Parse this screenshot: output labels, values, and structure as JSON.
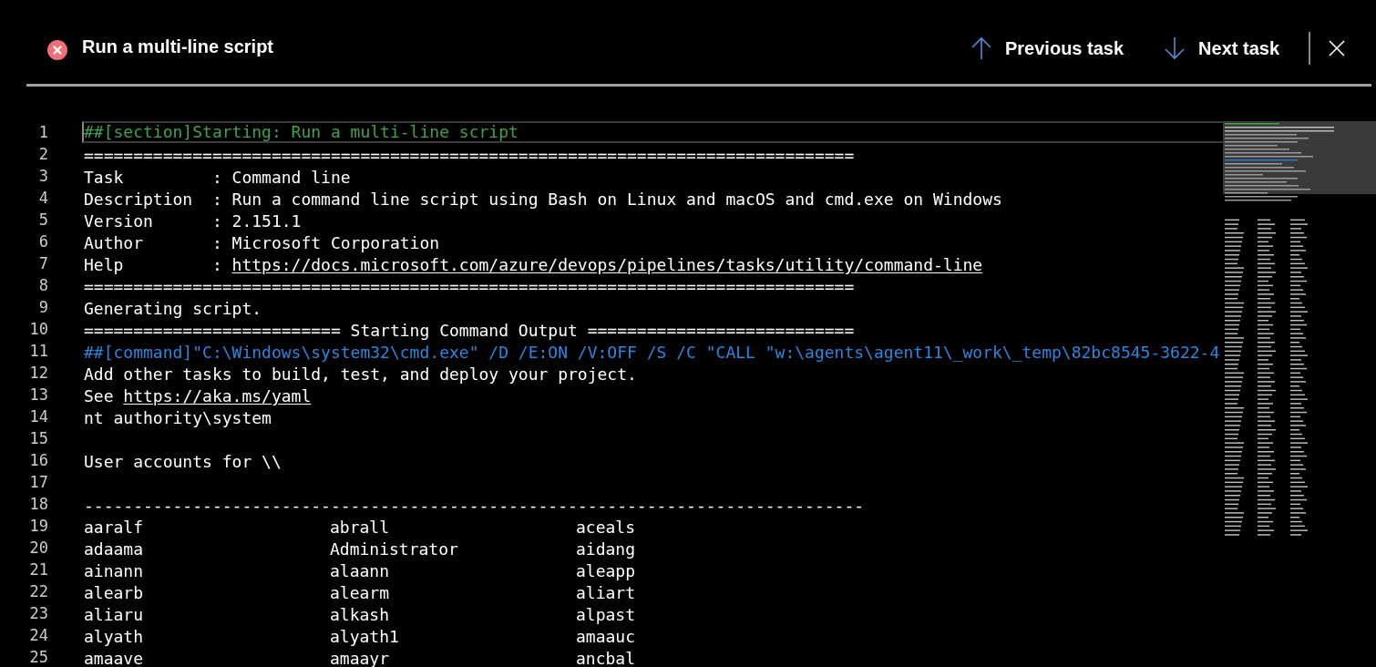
{
  "header": {
    "title": "Run a multi-line script",
    "failed": true,
    "previous": "Previous task",
    "next": "Next task"
  },
  "log": [
    {
      "number": "1",
      "kind": "section",
      "current": true,
      "segments": [
        {
          "text": "##[section]Starting: Run a multi-line script",
          "link": false
        }
      ]
    },
    {
      "number": "2",
      "kind": "plain",
      "current": false,
      "segments": [
        {
          "text": "==============================================================================",
          "link": false
        }
      ]
    },
    {
      "number": "3",
      "kind": "plain",
      "current": false,
      "segments": [
        {
          "text": "Task         : Command line",
          "link": false
        }
      ]
    },
    {
      "number": "4",
      "kind": "plain",
      "current": false,
      "segments": [
        {
          "text": "Description  : Run a command line script using Bash on Linux and macOS and cmd.exe on Windows",
          "link": false
        }
      ]
    },
    {
      "number": "5",
      "kind": "plain",
      "current": false,
      "segments": [
        {
          "text": "Version      : 2.151.1",
          "link": false
        }
      ]
    },
    {
      "number": "6",
      "kind": "plain",
      "current": false,
      "segments": [
        {
          "text": "Author       : Microsoft Corporation",
          "link": false
        }
      ]
    },
    {
      "number": "7",
      "kind": "plain",
      "current": false,
      "segments": [
        {
          "text": "Help         : ",
          "link": false
        },
        {
          "text": "https://docs.microsoft.com/azure/devops/pipelines/tasks/utility/command-line",
          "link": true
        }
      ]
    },
    {
      "number": "8",
      "kind": "plain",
      "current": false,
      "segments": [
        {
          "text": "==============================================================================",
          "link": false
        }
      ]
    },
    {
      "number": "9",
      "kind": "plain",
      "current": false,
      "segments": [
        {
          "text": "Generating script.",
          "link": false
        }
      ]
    },
    {
      "number": "10",
      "kind": "plain",
      "current": false,
      "segments": [
        {
          "text": "========================== Starting Command Output ===========================",
          "link": false
        }
      ]
    },
    {
      "number": "11",
      "kind": "command",
      "current": false,
      "segments": [
        {
          "text": "##[command]\"C:\\Windows\\system32\\cmd.exe\" /D /E:ON /V:OFF /S /C \"CALL \"w:\\agents\\agent11\\_work\\_temp\\82bc8545-3622-4",
          "link": false
        }
      ]
    },
    {
      "number": "12",
      "kind": "plain",
      "current": false,
      "segments": [
        {
          "text": "Add other tasks to build, test, and deploy your project.",
          "link": false
        }
      ]
    },
    {
      "number": "13",
      "kind": "plain",
      "current": false,
      "segments": [
        {
          "text": "See ",
          "link": false
        },
        {
          "text": "https://aka.ms/yaml",
          "link": true
        }
      ]
    },
    {
      "number": "14",
      "kind": "plain",
      "current": false,
      "segments": [
        {
          "text": "nt authority\\system",
          "link": false
        }
      ]
    },
    {
      "number": "15",
      "kind": "plain",
      "current": false
    },
    {
      "number": "16",
      "kind": "plain",
      "current": false,
      "segments": [
        {
          "text": "User accounts for \\\\",
          "link": false
        }
      ]
    },
    {
      "number": "17",
      "kind": "plain",
      "current": false
    },
    {
      "number": "18",
      "kind": "plain",
      "current": false,
      "segments": [
        {
          "text": "-------------------------------------------------------------------------------",
          "link": false
        }
      ]
    },
    {
      "number": "19",
      "kind": "columns",
      "current": false,
      "cells": [
        "aaralf",
        "abrall",
        "aceals"
      ]
    },
    {
      "number": "20",
      "kind": "columns",
      "current": false,
      "cells": [
        "adaama",
        "Administrator",
        "aidang"
      ]
    },
    {
      "number": "21",
      "kind": "columns",
      "current": false,
      "cells": [
        "ainann",
        "alaann",
        "aleapp"
      ]
    },
    {
      "number": "22",
      "kind": "columns",
      "current": false,
      "cells": [
        "alearb",
        "alearm",
        "aliart"
      ]
    },
    {
      "number": "23",
      "kind": "columns",
      "current": false,
      "cells": [
        "aliaru",
        "alkash",
        "alpast"
      ]
    },
    {
      "number": "24",
      "kind": "columns",
      "current": false,
      "cells": [
        "alyath",
        "alyath1",
        "amaauc"
      ]
    },
    {
      "number": "25",
      "kind": "columns",
      "current": false,
      "cells": [
        "amaave",
        "amaayr",
        "ancbal"
      ]
    }
  ]
}
